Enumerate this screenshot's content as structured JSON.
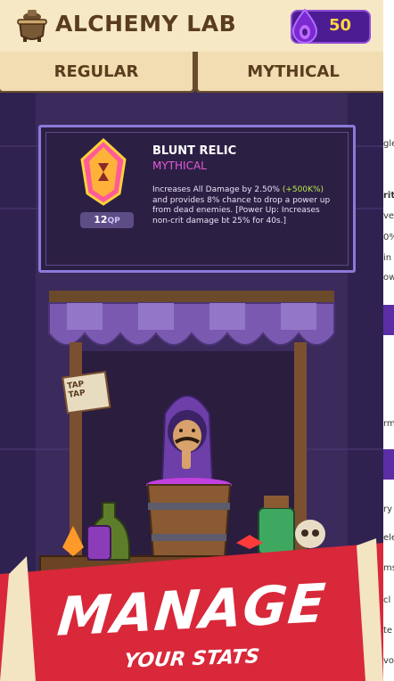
{
  "header": {
    "title": "ALCHEMY LAB",
    "gem_count": "50",
    "icons": [
      "cauldron-icon",
      "purple-gem-icon"
    ]
  },
  "tabs": [
    {
      "label": "REGULAR"
    },
    {
      "label": "MYTHICAL"
    }
  ],
  "relic": {
    "name": "BLUNT RELIC",
    "rarity": "MYTHICAL",
    "qp_value": "12",
    "qp_unit": "QP",
    "desc_1": "Increases All Damage by 2.50%",
    "desc_highlight": "(+500K%)",
    "desc_2": " and provides 8% chance to drop a power up from dead enemies. [Power Up: Increases non-crit damage bt 25% for 40s.]"
  },
  "sign_text": "TAP TAP",
  "promo": {
    "headline": "MANAGE",
    "subline": "YOUR STATS"
  },
  "side_fragments": [
    "gle",
    "rit",
    "ve",
    "0%",
    "in",
    "ow",
    "rm",
    "ry",
    "ele",
    "ms",
    "cl",
    "te",
    "vo"
  ],
  "colors": {
    "mythical": "#e45ad9",
    "highlight": "#b7e84a",
    "gem_bg": "#4c1c92",
    "gem_count": "#ffd83d",
    "banner": "#d8283a"
  }
}
